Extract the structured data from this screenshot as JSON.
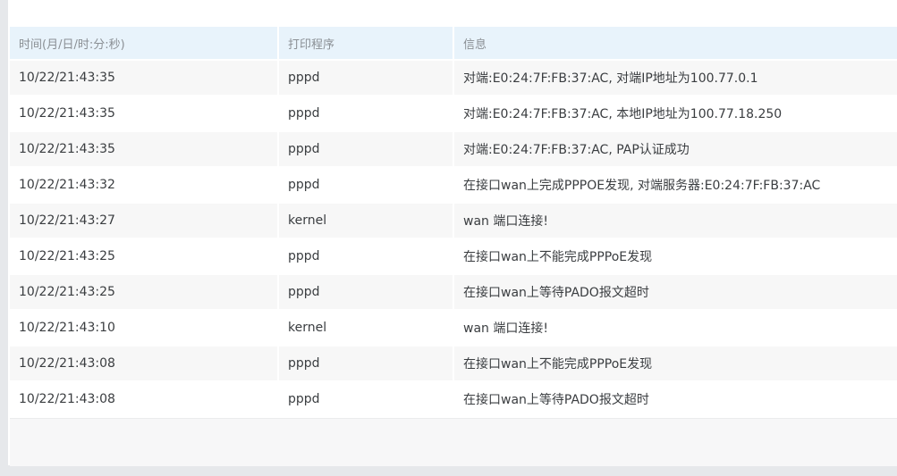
{
  "table": {
    "headers": [
      "时间(月/日/时:分:秒)",
      "打印程序",
      "信息"
    ],
    "rows": [
      {
        "time": "10/22/21:43:35",
        "program": "pppd",
        "message": "对端:E0:24:7F:FB:37:AC, 对端IP地址为100.77.0.1"
      },
      {
        "time": "10/22/21:43:35",
        "program": "pppd",
        "message": "对端:E0:24:7F:FB:37:AC, 本地IP地址为100.77.18.250"
      },
      {
        "time": "10/22/21:43:35",
        "program": "pppd",
        "message": "对端:E0:24:7F:FB:37:AC, PAP认证成功"
      },
      {
        "time": "10/22/21:43:32",
        "program": "pppd",
        "message": "在接口wan上完成PPPOE发现, 对端服务器:E0:24:7F:FB:37:AC"
      },
      {
        "time": "10/22/21:43:27",
        "program": "kernel",
        "message": "wan 端口连接!"
      },
      {
        "time": "10/22/21:43:25",
        "program": "pppd",
        "message": "在接口wan上不能完成PPPoE发现"
      },
      {
        "time": "10/22/21:43:25",
        "program": "pppd",
        "message": "在接口wan上等待PADO报文超时"
      },
      {
        "time": "10/22/21:43:10",
        "program": "kernel",
        "message": "wan 端口连接!"
      },
      {
        "time": "10/22/21:43:08",
        "program": "pppd",
        "message": "在接口wan上不能完成PPPoE发现"
      },
      {
        "time": "10/22/21:43:08",
        "program": "pppd",
        "message": "在接口wan上等待PADO报文超时"
      }
    ]
  },
  "colors": {
    "header_bg": "#e8f3fb",
    "row_alt_bg": "#f7f7f7",
    "page_bg": "#e6e8eb"
  }
}
